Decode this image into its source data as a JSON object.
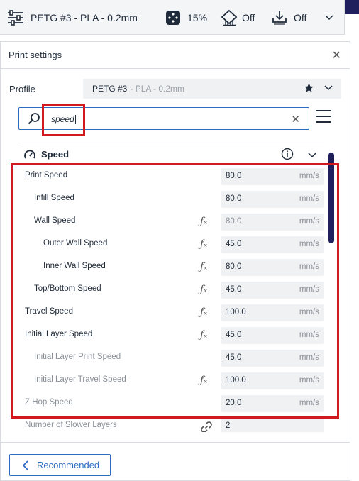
{
  "topbar": {
    "profile_label": "PETG #3 - PLA - 0.2mm",
    "infill_value": "15%",
    "support_value": "Off",
    "adhesion_value": "Off"
  },
  "panel": {
    "title": "Print settings",
    "close_icon": "close-icon"
  },
  "profile": {
    "label": "Profile",
    "name": "PETG #3",
    "detail": " - PLA - 0.2mm"
  },
  "search": {
    "value": "speed"
  },
  "category": {
    "title": "Speed"
  },
  "settings": [
    {
      "label": "Print Speed",
      "value": "80.0",
      "unit": "mm/s",
      "fx": false,
      "grey": false
    },
    {
      "label": "Infill Speed",
      "value": "80.0",
      "unit": "mm/s",
      "fx": false,
      "grey": false
    },
    {
      "label": "Wall Speed",
      "value": "80.0",
      "unit": "mm/s",
      "fx": true,
      "grey": false,
      "value_grey": true
    },
    {
      "label": "Outer Wall Speed",
      "value": "45.0",
      "unit": "mm/s",
      "fx": true,
      "grey": false
    },
    {
      "label": "Inner Wall Speed",
      "value": "80.0",
      "unit": "mm/s",
      "fx": true,
      "grey": false
    },
    {
      "label": "Top/Bottom Speed",
      "value": "45.0",
      "unit": "mm/s",
      "fx": true,
      "grey": false
    },
    {
      "label": "Travel Speed",
      "value": "100.0",
      "unit": "mm/s",
      "fx": true,
      "grey": false
    },
    {
      "label": "Initial Layer Speed",
      "value": "45.0",
      "unit": "mm/s",
      "fx": true,
      "grey": false
    },
    {
      "label": "Initial Layer Print Speed",
      "value": "45.0",
      "unit": "mm/s",
      "fx": false,
      "grey": true
    },
    {
      "label": "Initial Layer Travel Speed",
      "value": "100.0",
      "unit": "mm/s",
      "fx": true,
      "grey": true
    },
    {
      "label": "Z Hop Speed",
      "value": "20.0",
      "unit": "mm/s",
      "fx": false,
      "grey": true
    },
    {
      "label": "Number of Slower Layers",
      "value": "2",
      "unit": "",
      "fx": false,
      "grey": true,
      "link": true
    }
  ],
  "footer": {
    "recommended_label": "Recommended"
  },
  "colors": {
    "accent": "#2d6bc0",
    "highlight": "#d01a1f",
    "scrollbar": "#1e1f5c"
  }
}
